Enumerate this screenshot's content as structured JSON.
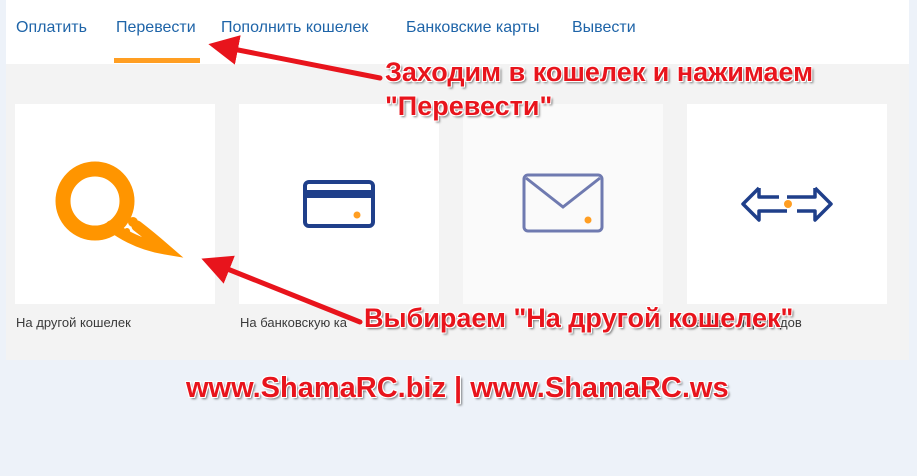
{
  "tabs": [
    {
      "label": "Оплатить"
    },
    {
      "label": "Перевести"
    },
    {
      "label": "Пополнить кошелек"
    },
    {
      "label": "Банковские карты"
    },
    {
      "label": "Вывести"
    }
  ],
  "active_tab": "Перевести",
  "cards": [
    {
      "label": "На другой кошелек",
      "icon": "qiwi-logo-icon"
    },
    {
      "label": "На банковскую ка",
      "icon": "bank-card-icon"
    },
    {
      "label": "",
      "icon": "envelope-icon"
    },
    {
      "label": "нежных переводов",
      "icon": "exchange-arrows-icon"
    }
  ],
  "annotations": {
    "top_line1": "Заходим в кошелек и нажимаем",
    "top_line2": "\"Перевести\"",
    "bottom": "Выбираем \"На другой кошелек\"",
    "footer": "www.ShamaRC.biz | www.ShamaRC.ws"
  },
  "colors": {
    "accent": "#ff9e22",
    "link": "#1e64a8",
    "icon": "#1f3f8a",
    "annotation": "#e8141c"
  }
}
